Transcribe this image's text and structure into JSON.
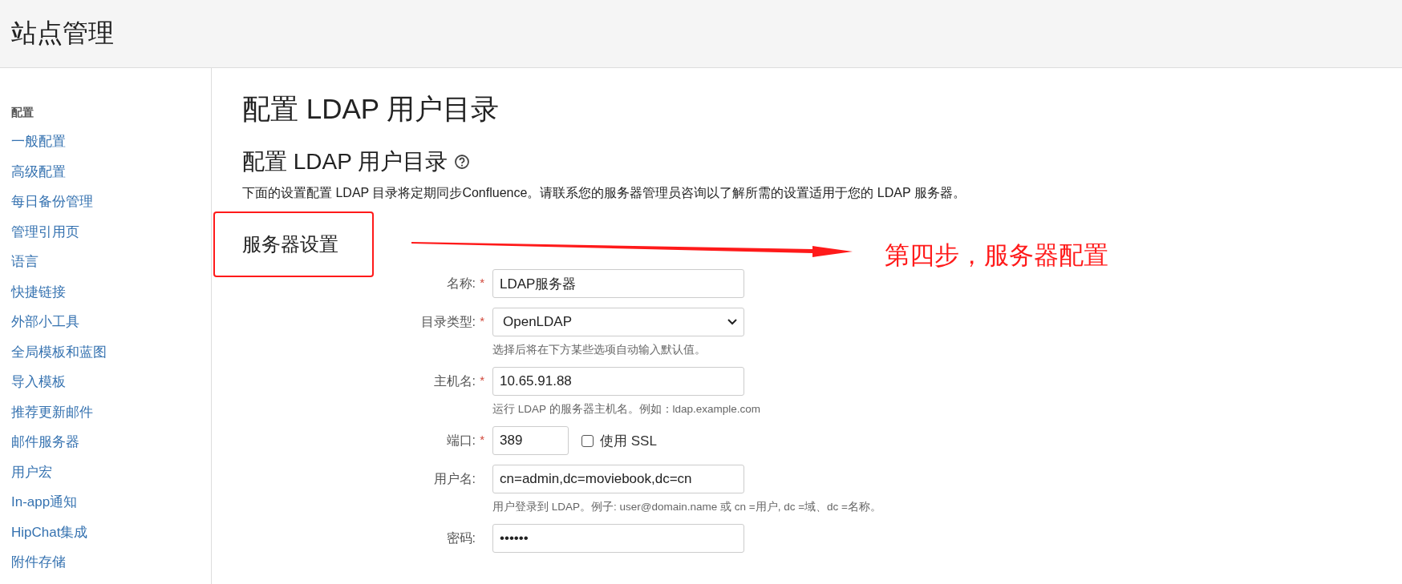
{
  "header": {
    "title": "站点管理"
  },
  "sidebar": {
    "heading": "配置",
    "items": [
      {
        "label": "一般配置"
      },
      {
        "label": "高级配置"
      },
      {
        "label": "每日备份管理"
      },
      {
        "label": "管理引用页"
      },
      {
        "label": "语言"
      },
      {
        "label": "快捷链接"
      },
      {
        "label": "外部小工具"
      },
      {
        "label": "全局模板和蓝图"
      },
      {
        "label": "导入模板"
      },
      {
        "label": "推荐更新邮件"
      },
      {
        "label": "邮件服务器"
      },
      {
        "label": "用户宏"
      },
      {
        "label": "In-app通知"
      },
      {
        "label": "HipChat集成"
      },
      {
        "label": "附件存储"
      }
    ]
  },
  "page_title": "配置 LDAP 用户目录",
  "section_title": "配置 LDAP 用户目录",
  "description": "下面的设置配置 LDAP 目录将定期同步Confluence。请联系您的服务器管理员咨询以了解所需的设置适用于您的 LDAP 服务器。",
  "server_settings": {
    "title": "服务器设置",
    "annotation": "第四步，服务器配置"
  },
  "form": {
    "required_mark": "*",
    "fields": [
      {
        "kind": "text",
        "label": "名称:",
        "required": true,
        "value": "LDAP服务器"
      },
      {
        "kind": "select",
        "label": "目录类型:",
        "required": true,
        "value": "OpenLDAP",
        "hint": "选择后将在下方某些选项自动输入默认值。"
      },
      {
        "kind": "text",
        "label": "主机名:",
        "required": true,
        "value": "10.65.91.88",
        "hint": "运行 LDAP 的服务器主机名。例如：ldap.example.com"
      },
      {
        "kind": "port",
        "label": "端口:",
        "required": true,
        "value": "389",
        "checkbox": {
          "label": "使用 SSL",
          "checked": false
        }
      },
      {
        "kind": "text",
        "label": "用户名:",
        "required": false,
        "value": "cn=admin,dc=moviebook,dc=cn",
        "hint": "用户登录到 LDAP。例子: user@domain.name 或 cn =用户, dc =域、dc =名称。"
      },
      {
        "kind": "text",
        "label": "密码:",
        "required": false,
        "value": "••••••"
      }
    ]
  }
}
